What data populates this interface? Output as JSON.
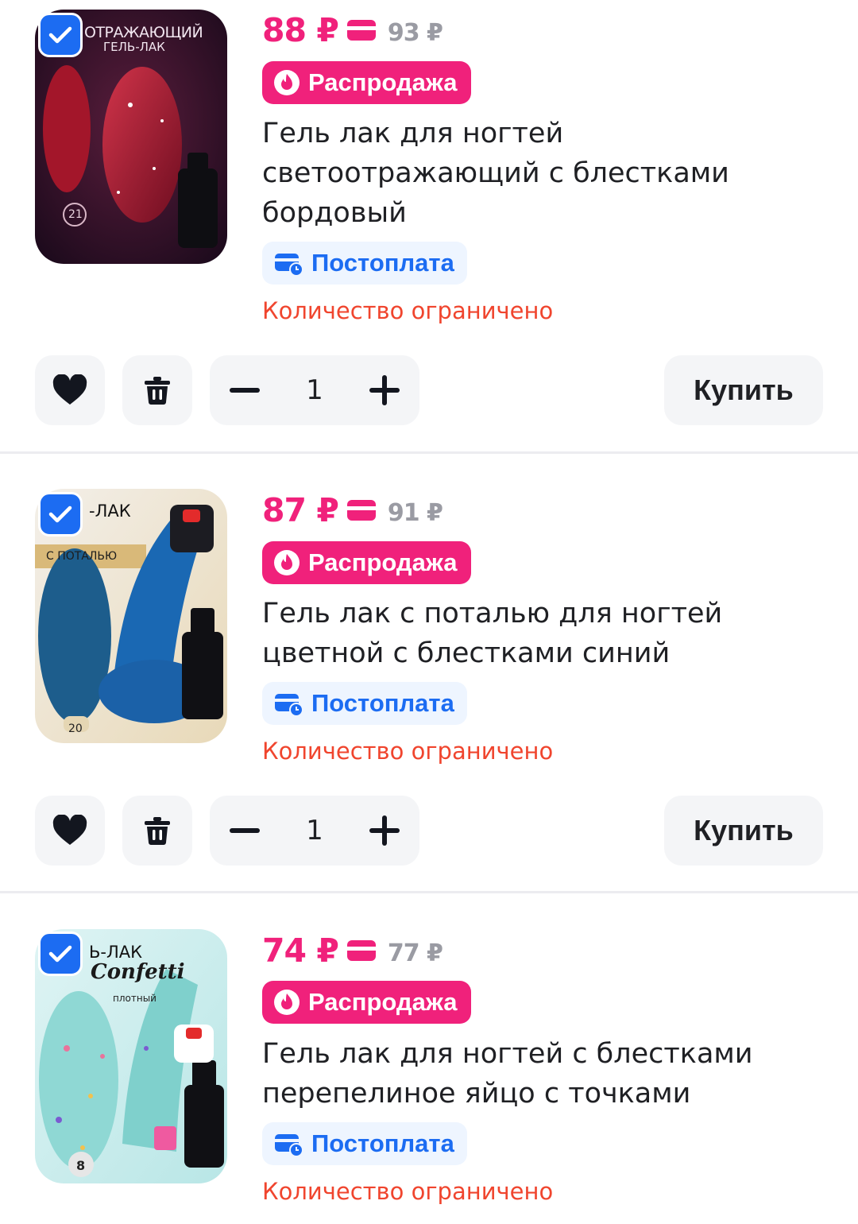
{
  "colors": {
    "accent": "#f0217b",
    "blue": "#1c6cf2",
    "warning": "#f0452e",
    "muted": "#9a9ba3"
  },
  "items": [
    {
      "price": "88 ₽",
      "old_price": "93 ₽",
      "sale_label": "Распродажа",
      "title": "Гель лак для ногтей светоотражающий с блестками бордовый",
      "payment_label": "Постоплата",
      "stock_note": "Количество ограничено",
      "quantity": "1",
      "buy_label": "Купить",
      "selected": true,
      "image_text": [
        "ОТРАЖАЮЩИЙ",
        "ГЕЛЬ-ЛАК",
        "21"
      ],
      "icons": [
        "checkmark-icon",
        "card-icon",
        "flame-icon",
        "payment-card-clock-icon",
        "heart-icon",
        "trash-icon",
        "minus-icon",
        "plus-icon"
      ]
    },
    {
      "price": "87 ₽",
      "old_price": "91 ₽",
      "sale_label": "Распродажа",
      "title": "Гель лак с поталью для ногтей цветной с блестками синий",
      "payment_label": "Постоплата",
      "stock_note": "Количество ограничено",
      "quantity": "1",
      "buy_label": "Купить",
      "selected": true,
      "image_text": [
        "-ЛАК",
        "С ПОТАЛЬЮ",
        "20"
      ]
    },
    {
      "price": "74 ₽",
      "old_price": "77 ₽",
      "sale_label": "Распродажа",
      "title": "Гель лак для ногтей с блестками перепелиное яйцо с точками",
      "payment_label": "Постоплата",
      "stock_note": "Количество ограничено",
      "selected": true,
      "image_text": [
        "Ь-ЛАК",
        "Confetti",
        "плотный",
        "8"
      ]
    }
  ]
}
